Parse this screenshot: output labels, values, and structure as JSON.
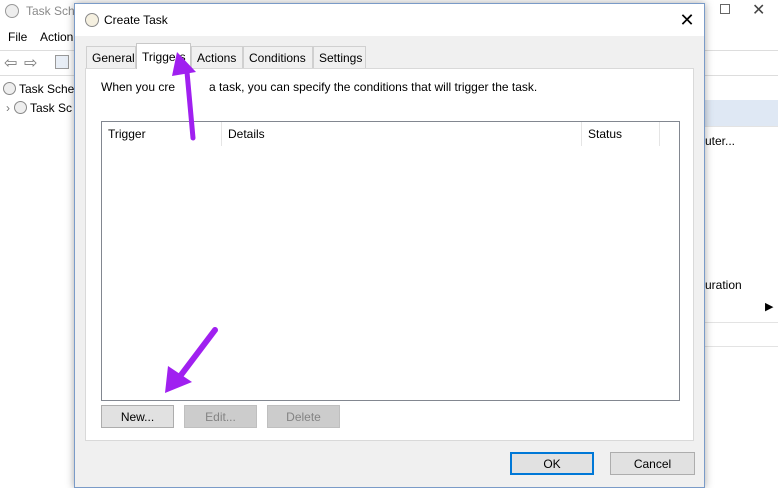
{
  "background": {
    "window_title": "Task Sche",
    "menu": [
      "File",
      "Action"
    ],
    "tree_items": [
      "Task Sche",
      "Task Sc"
    ],
    "actions": [
      "uter...",
      "uration"
    ]
  },
  "dialog": {
    "title": "Create Task",
    "tabs": [
      {
        "label": "General",
        "active": false
      },
      {
        "label": "Triggers",
        "active": true
      },
      {
        "label": "Actions",
        "active": false
      },
      {
        "label": "Conditions",
        "active": false
      },
      {
        "label": "Settings",
        "active": false
      }
    ],
    "description_before": "When you cre",
    "description_after": "a task, you can specify the conditions that will trigger the task.",
    "columns": [
      "Trigger",
      "Details",
      "Status"
    ],
    "buttons": {
      "new": "New...",
      "edit": "Edit...",
      "delete": "Delete",
      "ok": "OK",
      "cancel": "Cancel"
    }
  },
  "colors": {
    "annotation_arrow": "#a020f0",
    "focus_border": "#0078d7"
  },
  "icons": [
    "clock-icon",
    "close-icon",
    "back-arrow-icon",
    "forward-arrow-icon",
    "expand-chevron-icon"
  ]
}
